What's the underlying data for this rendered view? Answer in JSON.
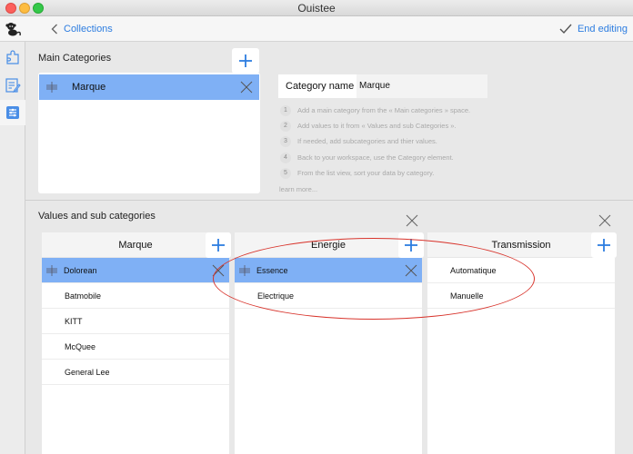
{
  "window": {
    "title": "Ouistee"
  },
  "toolbar": {
    "back_label": "Collections",
    "end_label": "End editing",
    "logo_icon": "monkey-logo-icon"
  },
  "rail": {
    "items": [
      {
        "icon": "puzzle-icon",
        "active": false
      },
      {
        "icon": "edit-form-icon",
        "active": false
      },
      {
        "icon": "categories-icon",
        "active": true
      }
    ]
  },
  "main_categories": {
    "title": "Main Categories",
    "items": [
      {
        "label": "Marque",
        "selected": true
      }
    ]
  },
  "category_name": {
    "label": "Category name :",
    "value": "Marque"
  },
  "help": {
    "steps": [
      {
        "num": "1",
        "text": "Add a main category from the « Main categories » space."
      },
      {
        "num": "2",
        "text": "Add values to it from « Values and sub Categories »."
      },
      {
        "num": "3",
        "text": "If needed, add subcategories and thier values."
      },
      {
        "num": "4",
        "text": "Back to your workspace, use the Category element."
      },
      {
        "num": "5",
        "text": "From the list view, sort your data by category."
      }
    ],
    "learn_more": "learn more..."
  },
  "values": {
    "title": "Values and sub categories",
    "columns": [
      {
        "header": "Marque",
        "rows": [
          "Dolorean",
          "Batmobile",
          "KITT",
          "McQuee",
          "General Lee"
        ],
        "selected": 0
      },
      {
        "header": "Energie",
        "rows": [
          "Essence",
          "Electrique"
        ],
        "selected": 0
      },
      {
        "header": "Transmission",
        "rows": [
          "Automatique",
          "Manuelle"
        ],
        "selected": -1
      }
    ]
  },
  "colors": {
    "accent": "#2d7de0",
    "selection": "#7fb0f5",
    "annotation": "#d8342c"
  }
}
